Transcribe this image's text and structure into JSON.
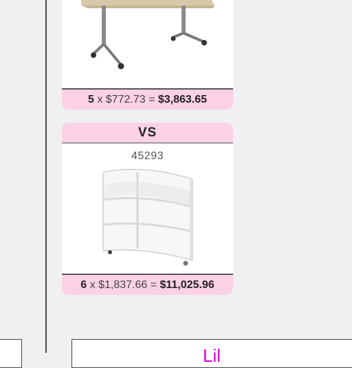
{
  "comparison": {
    "items": [
      {
        "image_icon": "table-image",
        "quantity": "5",
        "times": "x",
        "unit_price": "$772.73",
        "equals": "=",
        "total": "$3,863.65"
      },
      {
        "vs_label": "VS",
        "product_id": "45293",
        "image_icon": "shelving-image",
        "quantity": "6",
        "times": "x",
        "unit_price": "$1,837.66",
        "equals": "=",
        "total": "$11,025.96"
      }
    ]
  },
  "bottom_panel": {
    "heading_partial": "Lil"
  },
  "colors": {
    "header_pink": "#fbd1e6",
    "heading_magenta": "#e000d8"
  }
}
